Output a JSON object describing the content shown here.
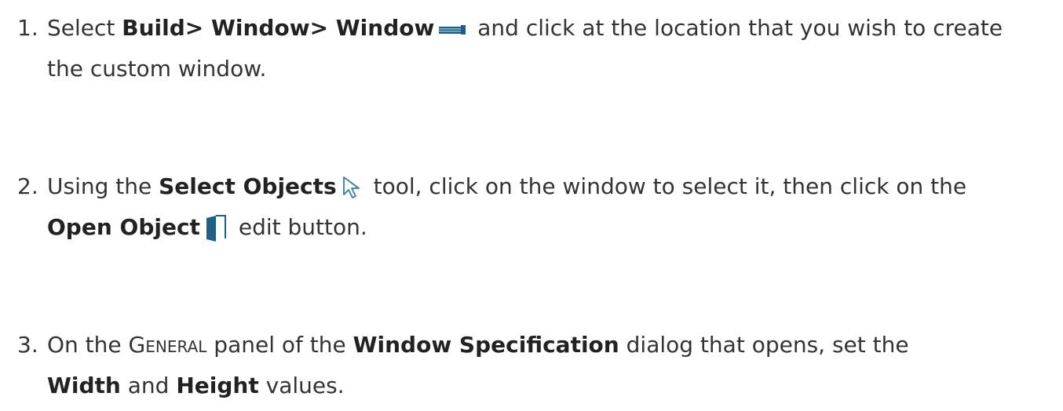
{
  "steps": [
    {
      "number": "1.",
      "pre": "Select ",
      "path": "Build> Window> Window",
      "icon": "window-tool-icon",
      "post": " and click at the location that you wish to create",
      "line2": "the custom window."
    },
    {
      "number": "2.",
      "pre": "Using the ",
      "tool": "Select Objects",
      "icon": "select-objects-arrow-icon",
      "post": " tool, click on the window to select it, then click on the",
      "button": "Open Object",
      "icon2": "open-object-door-icon",
      "post2": " edit button."
    },
    {
      "number": "3.",
      "pre": "On the ",
      "panel": "General",
      "mid": " panel of the ",
      "dialog": "Window Specification",
      "post": " dialog that opens, set the",
      "field1": "Width",
      "and": " and ",
      "field2": "Height",
      "post2": " values."
    }
  ],
  "colors": {
    "text": "#333333",
    "icon_blue": "#1f5f86"
  }
}
